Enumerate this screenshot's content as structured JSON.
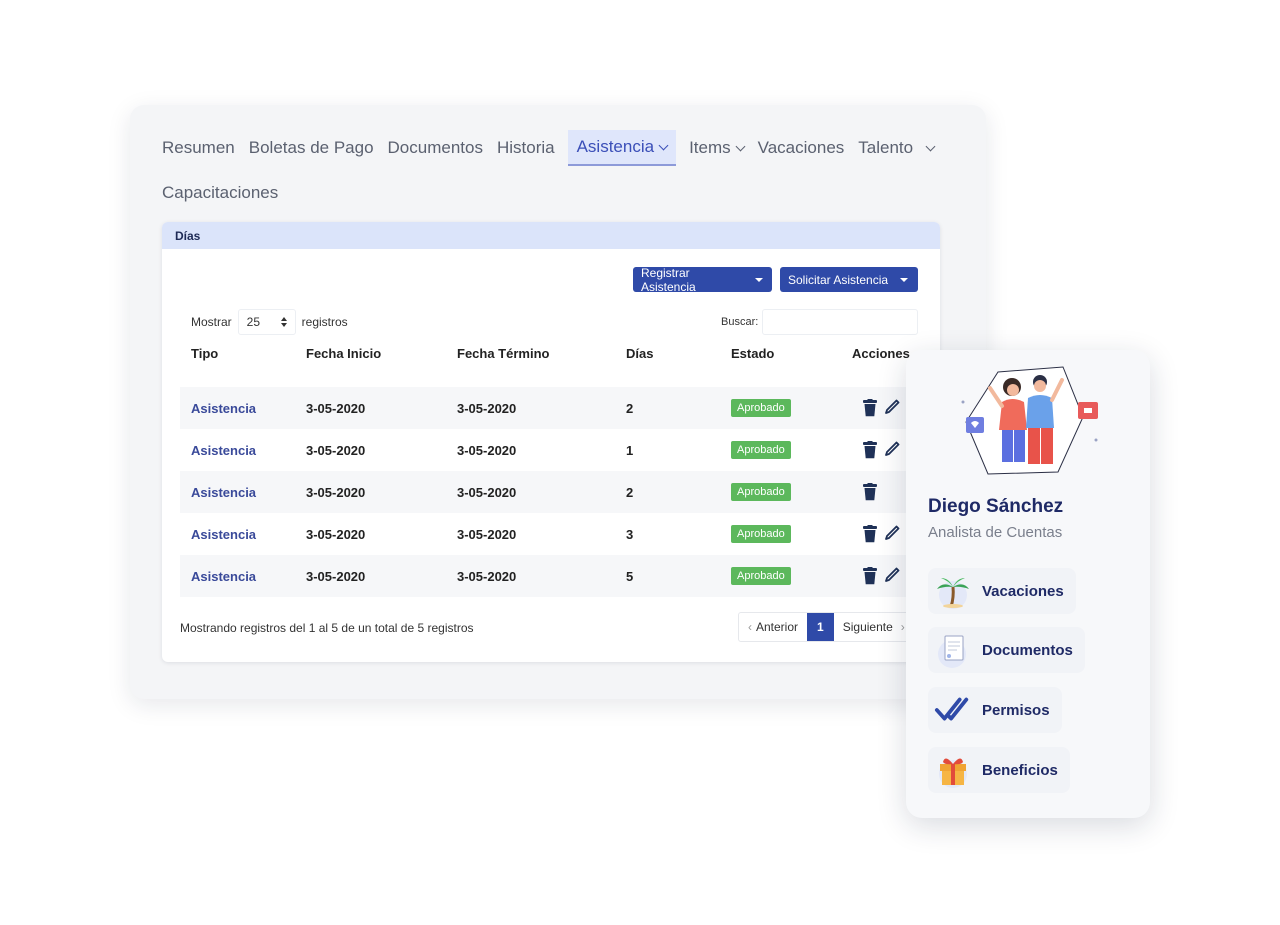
{
  "nav": {
    "row1": [
      "Resumen",
      "Boletas de Pago",
      "Documentos",
      "Historia"
    ],
    "active": "Asistencia",
    "items": "Items",
    "vacaciones": "Vacaciones",
    "talento": "Talento",
    "row2": "Capacitaciones"
  },
  "panel": {
    "title": "Días",
    "btn_registrar": "Registrar Asistencia",
    "btn_solicitar": "Solicitar Asistencia",
    "mostrar_label": "Mostrar",
    "page_size": "25",
    "registros_label": "registros",
    "buscar_label": "Buscar:",
    "columns": [
      "Tipo",
      "Fecha Inicio",
      "Fecha Término",
      "Días",
      "Estado",
      "Acciones"
    ],
    "rows": [
      {
        "tipo": "Asistencia",
        "inicio": "3-05-2020",
        "termino": "3-05-2020",
        "dias": "2",
        "estado": "Aprobado",
        "edit": true
      },
      {
        "tipo": "Asistencia",
        "inicio": "3-05-2020",
        "termino": "3-05-2020",
        "dias": "1",
        "estado": "Aprobado",
        "edit": true
      },
      {
        "tipo": "Asistencia",
        "inicio": "3-05-2020",
        "termino": "3-05-2020",
        "dias": "2",
        "estado": "Aprobado",
        "edit": false
      },
      {
        "tipo": "Asistencia",
        "inicio": "3-05-2020",
        "termino": "3-05-2020",
        "dias": "3",
        "estado": "Aprobado",
        "edit": true
      },
      {
        "tipo": "Asistencia",
        "inicio": "3-05-2020",
        "termino": "3-05-2020",
        "dias": "5",
        "estado": "Aprobado",
        "edit": true
      }
    ],
    "footer_info": "Mostrando registros del 1 al 5 de un total de 5 registros",
    "pager": {
      "prev": "Anterior",
      "current": "1",
      "next": "Siguiente"
    }
  },
  "profile": {
    "name": "Diego Sánchez",
    "role": "Analista de Cuentas",
    "menu": [
      "Vacaciones",
      "Documentos",
      "Permisos",
      "Beneficios"
    ]
  },
  "colors": {
    "primary": "#2f4aa8",
    "badge_green": "#5cb85c",
    "active_tab_bg": "#dfe6fb",
    "header_bg": "#dbe4fa"
  },
  "icons": {
    "delete": "trash-icon",
    "edit": "pencil-icon",
    "vacaciones": "palm-tree-icon",
    "documentos": "document-icon",
    "permisos": "double-check-icon",
    "beneficios": "gift-icon"
  }
}
